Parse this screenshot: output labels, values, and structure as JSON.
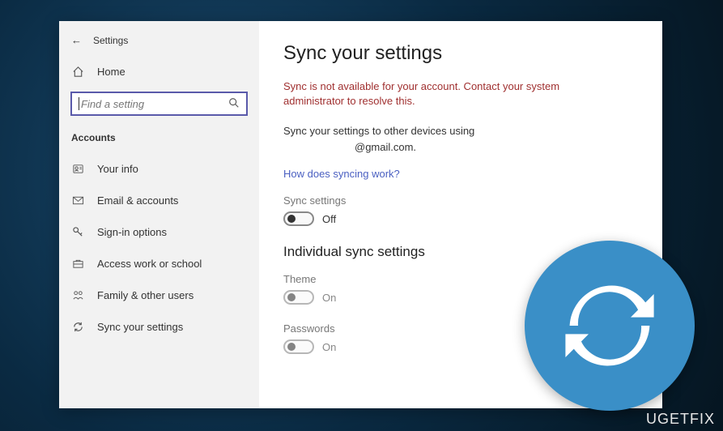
{
  "header": {
    "back_label": "Settings",
    "home_label": "Home",
    "search_placeholder": "Find a setting"
  },
  "sidebar": {
    "section": "Accounts",
    "items": [
      {
        "icon": "user",
        "label": "Your info"
      },
      {
        "icon": "mail",
        "label": "Email & accounts"
      },
      {
        "icon": "key",
        "label": "Sign-in options"
      },
      {
        "icon": "briefcase",
        "label": "Access work or school"
      },
      {
        "icon": "family",
        "label": "Family & other users"
      },
      {
        "icon": "sync",
        "label": "Sync your settings"
      }
    ]
  },
  "content": {
    "title": "Sync your settings",
    "error": "Sync is not available for your account. Contact your system administrator to resolve this.",
    "description_line1": "Sync your settings to other devices using",
    "description_line2": "@gmail.com.",
    "help_link": "How does syncing work?",
    "sync_settings_label": "Sync settings",
    "sync_settings_state": "Off",
    "individual_title": "Individual sync settings",
    "theme_label": "Theme",
    "theme_state": "On",
    "passwords_label": "Passwords",
    "passwords_state": "On"
  },
  "watermark": "UGETFIX"
}
